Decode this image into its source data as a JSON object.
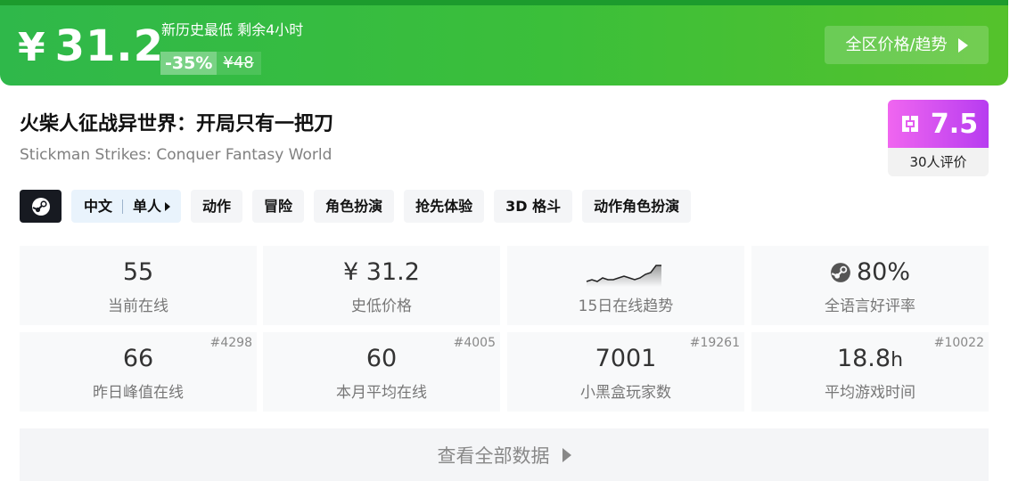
{
  "banner": {
    "currency": "¥",
    "price": "31.2",
    "note": "新历史最低 剩余4小时",
    "discount": "-35%",
    "original_price": "¥48",
    "region_button": "全区价格/趋势"
  },
  "game": {
    "title_cn": "火柴人征战异世界：开局只有一把刀",
    "title_en": "Stickman Strikes: Conquer Fantasy World"
  },
  "score": {
    "value": "7.5",
    "count_label": "30人评价",
    "colors": {
      "from": "#f066f0",
      "to": "#b73cf0"
    }
  },
  "tags": {
    "platform_icon": "steam-icon",
    "language": "中文",
    "mode": "单人",
    "items": [
      "动作",
      "冒险",
      "角色扮演",
      "抢先体验",
      "3D 格斗",
      "动作角色扮演"
    ]
  },
  "stats": {
    "current_online": {
      "value": "55",
      "label": "当前在线"
    },
    "lowest_price": {
      "value": "¥ 31.2",
      "label": "史低价格"
    },
    "trend": {
      "label": "15日在线趋势",
      "points": [
        3,
        4,
        3,
        5,
        4,
        4,
        5,
        6,
        5,
        4,
        5,
        7,
        8,
        12,
        12
      ]
    },
    "positive_rate": {
      "value": "80%",
      "label": "全语言好评率",
      "icon": "steam-icon"
    },
    "yesterday_peak": {
      "value": "66",
      "label": "昨日峰值在线",
      "rank": "#4298"
    },
    "monthly_avg": {
      "value": "60",
      "label": "本月平均在线",
      "rank": "#4005"
    },
    "heybox_players": {
      "value": "7001",
      "label": "小黑盒玩家数",
      "rank": "#19261"
    },
    "avg_playtime": {
      "value": "18.8",
      "unit": "h",
      "label": "平均游戏时间",
      "rank": "#10022"
    }
  },
  "footer": {
    "view_all": "查看全部数据"
  }
}
